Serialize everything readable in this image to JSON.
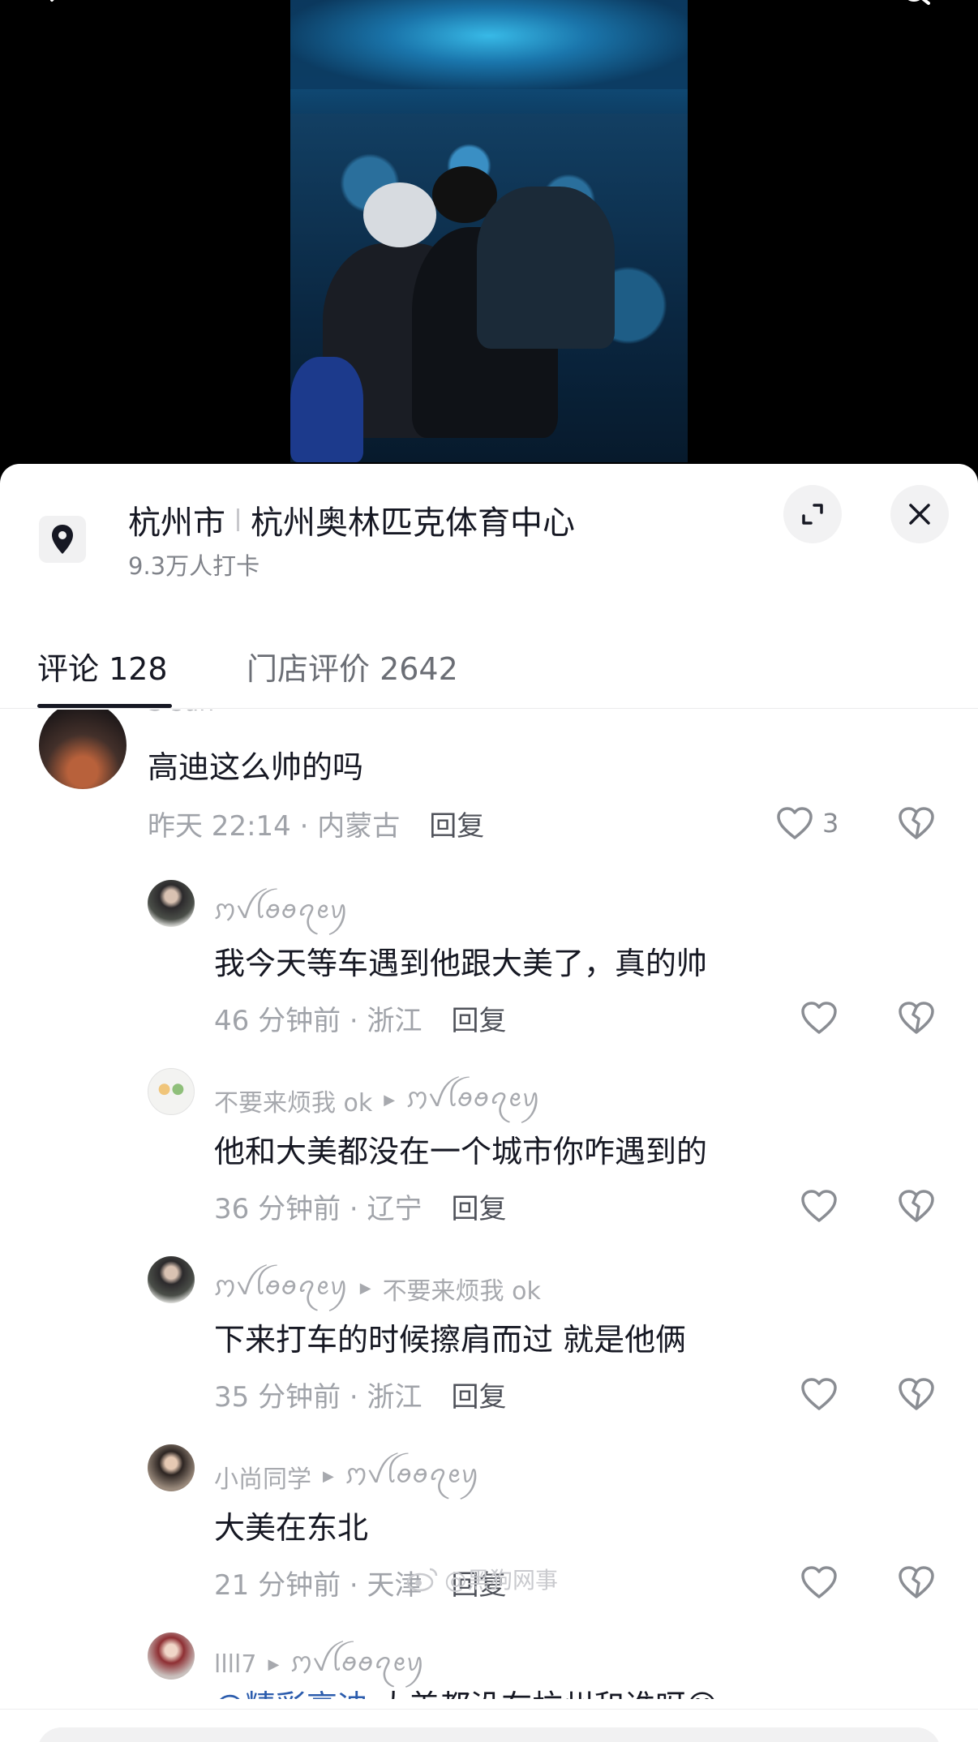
{
  "video": {
    "back_icon": "chevron-left-icon",
    "search_icon": "search-icon"
  },
  "place": {
    "city": "杭州市",
    "venue": "杭州奥林匹克体育中心",
    "checkins": "9.3万人打卡",
    "pin_icon": "map-pin-icon",
    "expand_icon": "expand-icon",
    "close_icon": "close-icon"
  },
  "tabs": [
    {
      "label": "评论 128",
      "active": true
    },
    {
      "label": "门店评价 2642",
      "active": false
    }
  ],
  "watermark": "@黑狗网事",
  "comments": [
    {
      "user": "S sun",
      "reply_to": "",
      "text": "高迪这么帅的吗",
      "time_loc": "昨天 22:14 · 内蒙古",
      "reply": "回复",
      "likes": "3"
    },
    {
      "user": "ꩀꪜꪶꪮꪮꪖꫀꪗ",
      "reply_to": "",
      "text": "我今天等车遇到他跟大美了，真的帅",
      "time_loc": "46 分钟前 · 浙江",
      "reply": "回复",
      "likes": ""
    },
    {
      "user": "不要来烦我 ok",
      "reply_to": "ꩀꪜꪶꪮꪮꪖꫀꪗ",
      "text": "他和大美都没在一个城市你咋遇到的",
      "time_loc": "36 分钟前 · 辽宁",
      "reply": "回复",
      "likes": ""
    },
    {
      "user": "ꩀꪜꪶꪮꪮꪖꫀꪗ",
      "reply_to": "不要来烦我 ok",
      "text": "下来打车的时候擦肩而过 就是他俩",
      "time_loc": "35 分钟前 · 浙江",
      "reply": "回复",
      "likes": ""
    },
    {
      "user": "小尚同学",
      "reply_to": "ꩀꪜꪶꪮꪮꪖꫀꪗ",
      "text": "大美在东北",
      "time_loc": "21 分钟前 · 天津",
      "reply": "回复",
      "likes": ""
    },
    {
      "user": "llll7",
      "reply_to": "ꩀꪜꪶꪮꪮꪖꫀꪗ",
      "mention": "@精彩高迪",
      "text": " 大美都没在杭州和谁呀",
      "emoji": "😅",
      "time_loc": "",
      "reply": "",
      "likes": ""
    }
  ],
  "colors": {
    "accent_text": "#161823",
    "muted": "#a0a3a9",
    "mention": "#2b5cad",
    "sheet_bg": "#ffffff"
  }
}
